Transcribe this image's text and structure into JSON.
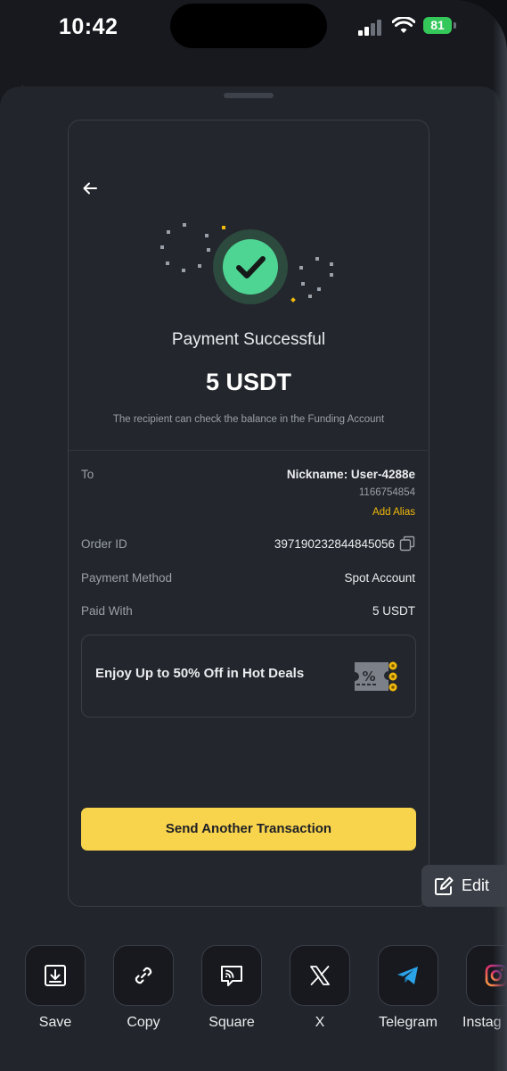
{
  "status_bar": {
    "time": "10:42",
    "battery": "81"
  },
  "receipt": {
    "title": "Payment Successful",
    "amount": "5 USDT",
    "subtitle": "The recipient can check the balance in the Funding Account",
    "to_label": "To",
    "nickname": "Nickname: User-4288e",
    "user_id": "1166754854",
    "add_alias": "Add Alias",
    "order_id_label": "Order ID",
    "order_id": "397190232844845056",
    "payment_method_label": "Payment Method",
    "payment_method": "Spot Account",
    "paid_with_label": "Paid With",
    "paid_with": "5 USDT"
  },
  "promo": {
    "text": "Enjoy Up to 50% Off in Hot Deals"
  },
  "actions": {
    "send_another": "Send Another Transaction",
    "edit": "Edit"
  },
  "share": [
    {
      "label": "Save",
      "icon": "save-icon"
    },
    {
      "label": "Copy",
      "icon": "link-icon"
    },
    {
      "label": "Square",
      "icon": "square-icon"
    },
    {
      "label": "X",
      "icon": "x-logo-icon"
    },
    {
      "label": "Telegram",
      "icon": "telegram-icon"
    },
    {
      "label": "Instag",
      "icon": "instagram-icon"
    }
  ],
  "colors": {
    "accent": "#f8d34c",
    "success": "#2ebd85",
    "link": "#f0b90b",
    "background": "#22252b"
  }
}
